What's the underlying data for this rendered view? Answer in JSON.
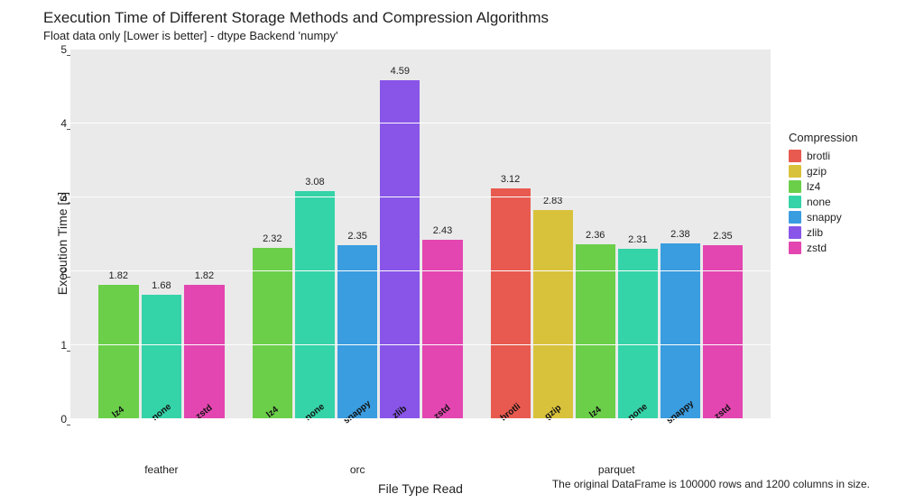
{
  "title": "Execution Time of Different Storage Methods and Compression Algorithms",
  "subtitle": "Float data only [Lower is better] - dtype Backend 'numpy'",
  "ylabel": "Execution Time [s]",
  "xlabel": "File Type Read",
  "footnote": "The original DataFrame is 100000 rows and 1200 columns in size.",
  "legend_title": "Compression",
  "colors": {
    "brotli": "#e85a4f",
    "gzip": "#d9c23b",
    "lz4": "#6bcf4a",
    "none": "#35d3a8",
    "snappy": "#3a9de0",
    "zlib": "#8855e8",
    "zstd": "#e346b0"
  },
  "legend_order": [
    "brotli",
    "gzip",
    "lz4",
    "none",
    "snappy",
    "zlib",
    "zstd"
  ],
  "chart_data": {
    "type": "bar",
    "ylim": [
      0,
      5
    ],
    "yticks": [
      0,
      1,
      2,
      3,
      4,
      5
    ],
    "groups": [
      "feather",
      "orc",
      "parquet"
    ],
    "series": [
      {
        "group": "feather",
        "name": "lz4",
        "value": 1.82
      },
      {
        "group": "feather",
        "name": "none",
        "value": 1.68
      },
      {
        "group": "feather",
        "name": "zstd",
        "value": 1.82
      },
      {
        "group": "orc",
        "name": "lz4",
        "value": 2.32
      },
      {
        "group": "orc",
        "name": "none",
        "value": 3.08
      },
      {
        "group": "orc",
        "name": "snappy",
        "value": 2.35
      },
      {
        "group": "orc",
        "name": "zlib",
        "value": 4.59
      },
      {
        "group": "orc",
        "name": "zstd",
        "value": 2.43
      },
      {
        "group": "parquet",
        "name": "brotli",
        "value": 3.12
      },
      {
        "group": "parquet",
        "name": "gzip",
        "value": 2.83
      },
      {
        "group": "parquet",
        "name": "lz4",
        "value": 2.36
      },
      {
        "group": "parquet",
        "name": "none",
        "value": 2.31
      },
      {
        "group": "parquet",
        "name": "snappy",
        "value": 2.38
      },
      {
        "group": "parquet",
        "name": "zstd",
        "value": 2.35
      }
    ],
    "title": "Execution Time of Different Storage Methods and Compression Algorithms",
    "xlabel": "File Type Read",
    "ylabel": "Execution Time [s]"
  }
}
